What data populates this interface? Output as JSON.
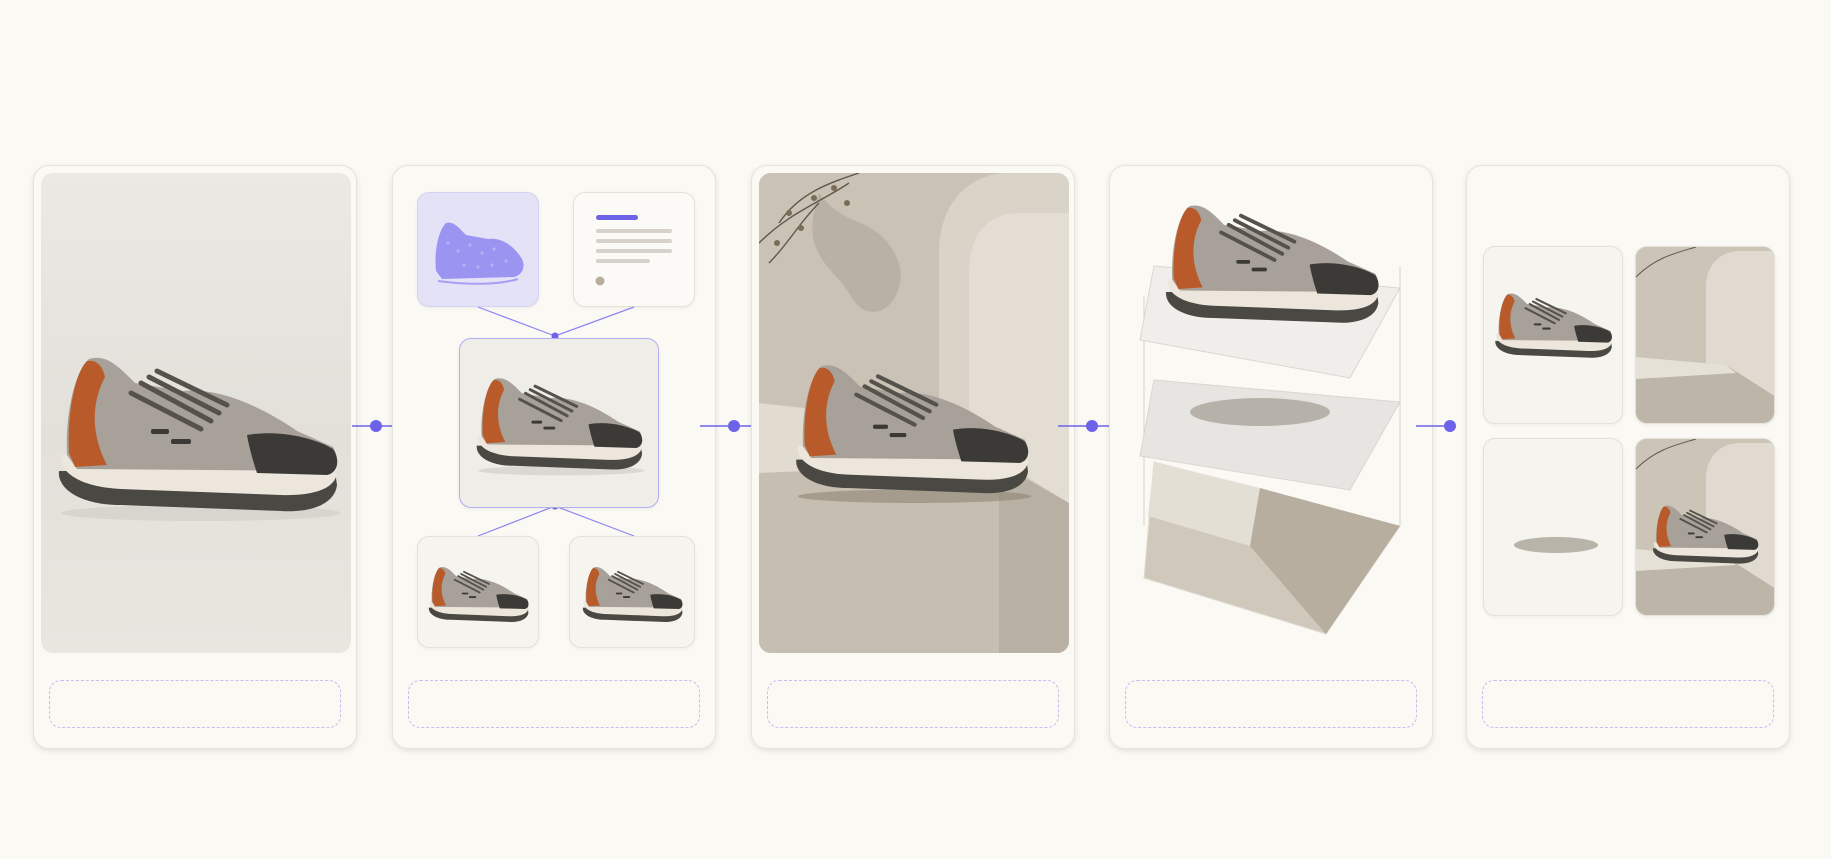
{
  "diagram": {
    "stages": [
      {
        "id": "input-photo",
        "caption": ""
      },
      {
        "id": "analysis",
        "caption": ""
      },
      {
        "id": "scene-generation",
        "caption": ""
      },
      {
        "id": "layer-decomposition",
        "caption": ""
      },
      {
        "id": "output-variants",
        "caption": ""
      }
    ],
    "colors": {
      "accent": "#6c63e8",
      "background": "#fbf9f3",
      "card": "#fbf9f4",
      "caption_border": "#c6bdf0",
      "shoe_upper": "#a8a199",
      "shoe_accent": "#b85a2a",
      "shoe_toe": "#3b3a36",
      "shoe_sole": "#ece6dc"
    },
    "icons": [
      "arrow-right-icon",
      "point-cloud-shoe-icon",
      "document-icon"
    ]
  }
}
